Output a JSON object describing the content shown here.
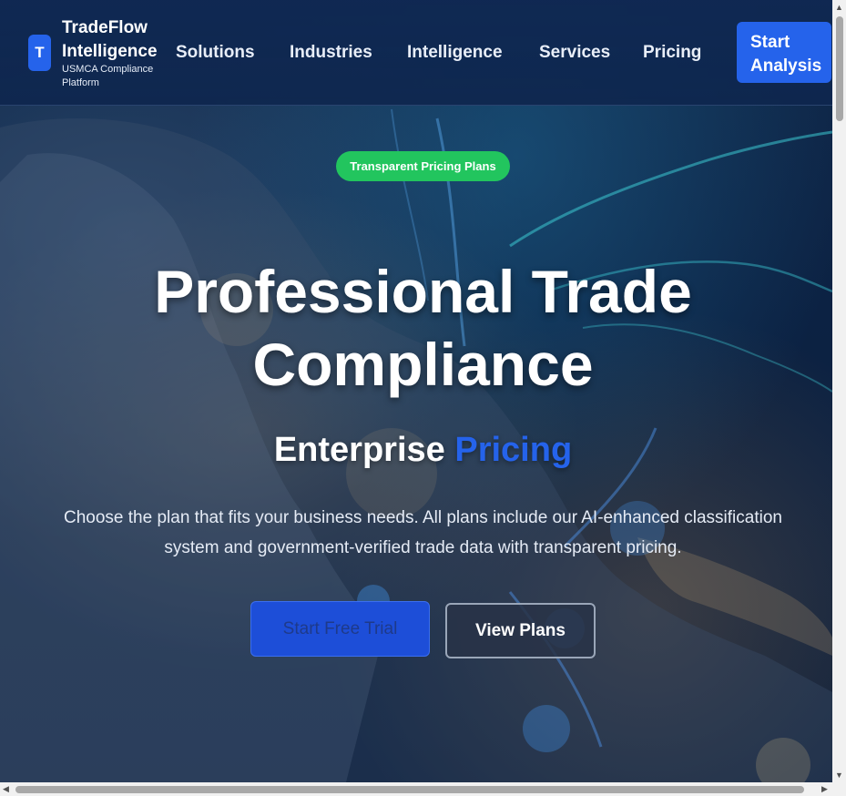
{
  "brand": {
    "logo_letter": "T",
    "name": "TradeFlow Intelligence",
    "subtitle": "USMCA Compliance Platform"
  },
  "nav": {
    "items": [
      "Solutions",
      "Industries",
      "Intelligence",
      "Services",
      "Pricing"
    ],
    "cta_label": "Start Analysis"
  },
  "hero": {
    "badge": "Transparent Pricing Plans",
    "headline_line1": "Professional Trade",
    "headline_line2": "Compliance",
    "subhead_plain": "Enterprise",
    "subhead_accent": "Pricing",
    "description": "Choose the plan that fits your business needs. All plans include our AI-enhanced classification system and government-verified trade data with transparent pricing.",
    "primary_button": "Start Free Trial",
    "secondary_button": "View Plans"
  },
  "colors": {
    "accent": "#2563eb",
    "badge_green": "#22c55e",
    "header_bg": "#0f2852"
  }
}
